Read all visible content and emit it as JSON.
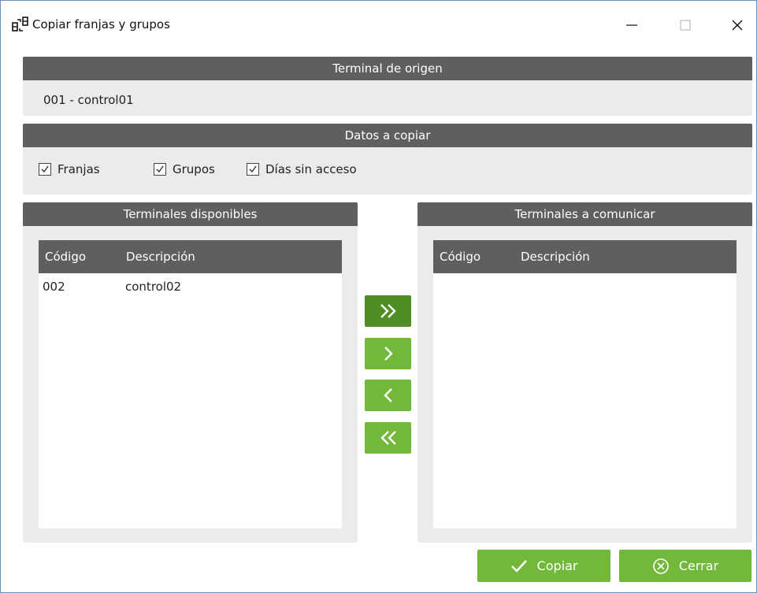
{
  "window": {
    "title": "Copiar franjas y grupos",
    "icon": "copy-terminals-icon",
    "controls": [
      "minimize-icon",
      "maximize-icon",
      "close-icon"
    ]
  },
  "origin": {
    "header": "Terminal de origen",
    "value": "001 - control01"
  },
  "data_to_copy": {
    "header": "Datos a copiar",
    "options": [
      {
        "label": "Franjas",
        "checked": true
      },
      {
        "label": "Grupos",
        "checked": true
      },
      {
        "label": "Días sin acceso",
        "checked": true
      }
    ]
  },
  "available": {
    "header": "Terminales disponibles",
    "columns": [
      "Código",
      "Descripción"
    ],
    "rows": [
      {
        "code": "002",
        "description": "control02"
      }
    ]
  },
  "to_communicate": {
    "header": "Terminales a comunicar",
    "columns": [
      "Código",
      "Descripción"
    ],
    "rows": []
  },
  "move_buttons": [
    "move-all-right-icon",
    "move-right-icon",
    "move-left-icon",
    "move-all-left-icon"
  ],
  "actions": {
    "copy_label": "Copiar",
    "close_label": "Cerrar"
  },
  "colors": {
    "header_bg": "#5f5f5f",
    "panel_bg": "#ebebeb",
    "accent_green": "#72b83b",
    "accent_green_dark": "#4f8e25"
  }
}
